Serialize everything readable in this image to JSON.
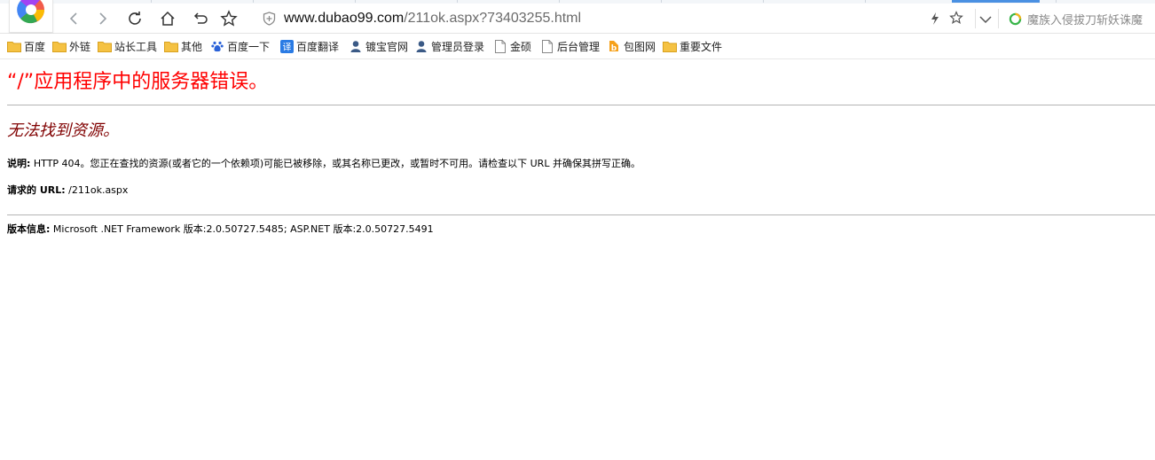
{
  "browser": {
    "url_host": "www.dubao99.com",
    "url_path": "/211ok.aspx?73403255.html",
    "search_placeholder": "魔族入侵拔刀斩妖诛魔"
  },
  "bookmarks": [
    {
      "label": "百度",
      "icon": "folder-icon"
    },
    {
      "label": "外链",
      "icon": "folder-icon"
    },
    {
      "label": "站长工具",
      "icon": "folder-icon"
    },
    {
      "label": "其他",
      "icon": "folder-icon"
    },
    {
      "label": "百度一下",
      "icon": "baidu-paw-icon"
    },
    {
      "label": "百度翻译",
      "icon": "translate-icon"
    },
    {
      "label": "镀宝官网",
      "icon": "person-icon"
    },
    {
      "label": "管理员登录",
      "icon": "person-icon"
    },
    {
      "label": "金硕",
      "icon": "page-icon"
    },
    {
      "label": "后台管理",
      "icon": "page-icon"
    },
    {
      "label": "包图网",
      "icon": "baotu-icon"
    },
    {
      "label": "重要文件",
      "icon": "folder-icon"
    }
  ],
  "page": {
    "title": "“/”应用程序中的服务器错误。",
    "subtitle": "无法找到资源。",
    "description_label": "说明:",
    "description_text": "HTTP 404。您正在查找的资源(或者它的一个依赖项)可能已被移除，或其名称已更改，或暂时不可用。请检查以下 URL 并确保其拼写正确。",
    "requested_url_label": "请求的 URL:",
    "requested_url_value": "/211ok.aspx",
    "version_label": "版本信息:",
    "version_text": "Microsoft .NET Framework 版本:2.0.50727.5485; ASP.NET 版本:2.0.50727.5491"
  },
  "colors": {
    "title": "#ff0000",
    "subtitle": "#800000",
    "folder": "#f5c243",
    "tab_active": "#4a90e2"
  }
}
